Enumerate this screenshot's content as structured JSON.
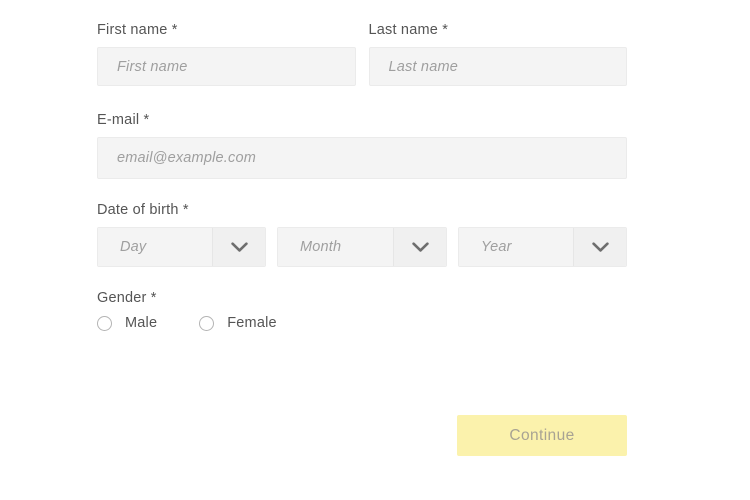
{
  "form": {
    "fields": {
      "first_name": {
        "label": "First name *",
        "placeholder": "First name",
        "value": ""
      },
      "last_name": {
        "label": "Last name *",
        "placeholder": "Last name",
        "value": ""
      },
      "email": {
        "label": "E-mail *",
        "placeholder": "email@example.com",
        "value": ""
      },
      "date_of_birth": {
        "label": "Date of birth *",
        "day": {
          "placeholder": "Day",
          "value": "",
          "icon": "chevron-down-icon"
        },
        "month": {
          "placeholder": "Month",
          "value": "",
          "icon": "chevron-down-icon"
        },
        "year": {
          "placeholder": "Year",
          "value": "",
          "icon": "chevron-down-icon"
        }
      },
      "gender": {
        "label": "Gender *",
        "options": [
          {
            "label": "Male",
            "selected": false
          },
          {
            "label": "Female",
            "selected": false
          }
        ]
      }
    },
    "submit": {
      "label": "Continue"
    }
  },
  "colors": {
    "page_background": "#ffffff",
    "input_background": "#f4f4f4",
    "input_border": "#ebebeb",
    "select_arrow_background": "#f0f0f0",
    "label_text": "#555555",
    "placeholder_text": "#9f9f9f",
    "button_background": "#fbf2ac",
    "button_text": "#a8a393",
    "radio_outline": "#b4b4b4"
  }
}
